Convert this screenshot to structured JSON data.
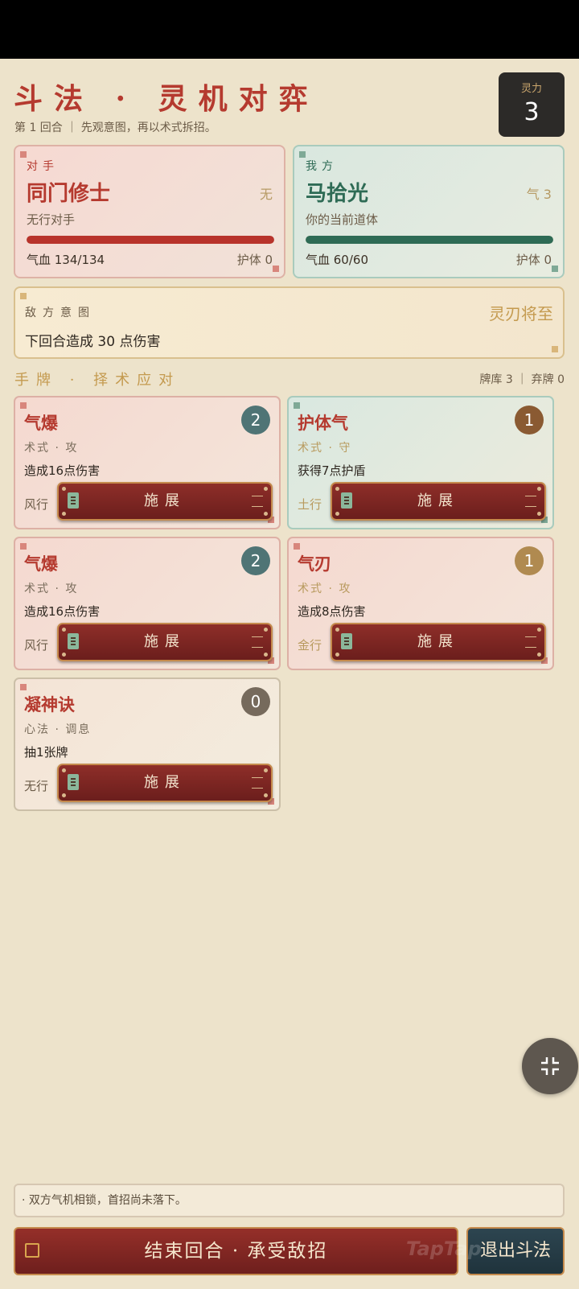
{
  "header": {
    "title": "斗法 · 灵机对弈",
    "subtitle": "第 1 回合 ｜ 先观意图，再以术式拆招。",
    "mana_label": "灵力",
    "mana_value": "3"
  },
  "enemy": {
    "tag": "对手",
    "name": "同门修士",
    "element": "无",
    "desc": "无行对手",
    "hp_text": "气血 134/134",
    "hp_fraction": 1.0,
    "shield_text": "护体 0"
  },
  "player": {
    "tag": "我方",
    "name": "马拾光",
    "qi_text": "气 3",
    "desc": "你的当前道体",
    "hp_text": "气血 60/60",
    "hp_fraction": 1.0,
    "shield_text": "护体 0"
  },
  "intent": {
    "label": "敌方意图",
    "status": "灵刃将至",
    "text": "下回合造成 30 点伤害"
  },
  "hand": {
    "title": "手牌 · 择术应对",
    "deck_info": "牌库 3 ｜ 弃牌 0",
    "cast_label": "施展",
    "cards": [
      {
        "name": "气爆",
        "cost": "2",
        "type": "术式 · 攻",
        "effect": "造成16点伤害",
        "element": "风行"
      },
      {
        "name": "护体气",
        "cost": "1",
        "type": "术式 · 守",
        "effect": "获得7点护盾",
        "element": "土行"
      },
      {
        "name": "气爆",
        "cost": "2",
        "type": "术式 · 攻",
        "effect": "造成16点伤害",
        "element": "风行"
      },
      {
        "name": "气刃",
        "cost": "1",
        "type": "术式 · 攻",
        "effect": "造成8点伤害",
        "element": "金行"
      },
      {
        "name": "凝神诀",
        "cost": "0",
        "type": "心法 · 调息",
        "effect": "抽1张牌",
        "element": "无行"
      }
    ]
  },
  "log": {
    "text": "· 双方气机相锁，首招尚未落下。"
  },
  "footer": {
    "end_turn": "结束回合 · 承受敌招",
    "exit": "退出斗法",
    "watermark": "TapTap"
  },
  "icons": {
    "fab": "collapse-arrows-icon",
    "talisman": "talisman-icon",
    "lock": "lock-icon"
  },
  "colors": {
    "accent_red": "#b53a2f",
    "hp_enemy": "#b8332b",
    "hp_player": "#2e6b55",
    "gold": "#c49a4f",
    "cost_teal": "#4f7475",
    "cost_brown": "#8a5a32",
    "cost_gold": "#b08a50",
    "cost_gray": "#766a5c"
  }
}
